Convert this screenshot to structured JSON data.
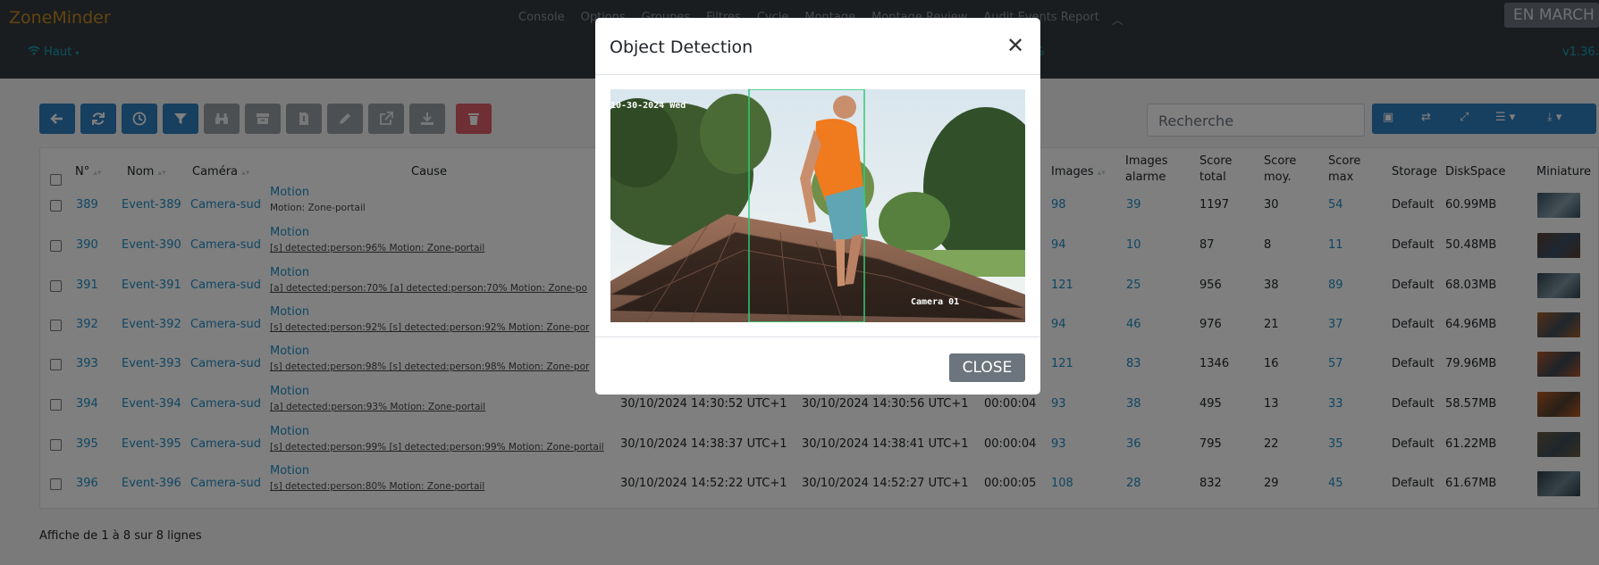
{
  "app": {
    "brand": "ZoneMinder",
    "status_button": "EN MARCH",
    "version": "v1.36."
  },
  "nav": [
    "Console",
    "Options",
    "Groupes",
    "Filtres",
    "Cycle",
    "Montage",
    "Montage Review",
    "Audit Events Report"
  ],
  "nav_collapse_icon": "chevron-up-icon",
  "sub_nav": {
    "bandwidth": "Haut",
    "load_pct": "%"
  },
  "toolbar": {
    "buttons": [
      {
        "name": "back",
        "icon": "arrow-left-icon",
        "state": "enabled"
      },
      {
        "name": "refresh",
        "icon": "refresh-icon",
        "state": "enabled"
      },
      {
        "name": "reset",
        "icon": "history-icon",
        "state": "enabled"
      },
      {
        "name": "filter",
        "icon": "filter-icon",
        "state": "enabled"
      },
      {
        "name": "view",
        "icon": "binoculars-icon",
        "state": "disabled"
      },
      {
        "name": "archive",
        "icon": "archive-icon",
        "state": "disabled"
      },
      {
        "name": "unarchive",
        "icon": "unarchive-icon",
        "state": "disabled"
      },
      {
        "name": "edit",
        "icon": "pencil-icon",
        "state": "disabled"
      },
      {
        "name": "export",
        "icon": "external-link-icon",
        "state": "disabled"
      },
      {
        "name": "download",
        "icon": "download-icon",
        "state": "disabled"
      },
      {
        "name": "delete",
        "icon": "trash-icon",
        "state": "danger"
      }
    ],
    "search_placeholder": "Recherche"
  },
  "table": {
    "headers": {
      "id": "N°",
      "name": "Nom",
      "camera": "Caméra",
      "cause": "Cause",
      "frames": "Images",
      "alarm_frames_1": "Images",
      "alarm_frames_2": "alarme",
      "total_score_1": "Score",
      "total_score_2": "total",
      "avg_score_1": "Score",
      "avg_score_2": "moy.",
      "max_score_1": "Score",
      "max_score_2": "max",
      "storage": "Storage",
      "disk": "DiskSpace",
      "thumb": "Miniature"
    },
    "rows": [
      {
        "id": "389",
        "name": "Event-389",
        "camera": "Camera-sud",
        "cause": "Motion",
        "notes": "Motion: Zone-portail",
        "start": "",
        "end": "",
        "duration": "",
        "frames": "98",
        "alarm": "39",
        "total": "1197",
        "avg": "30",
        "max": "54",
        "storage": "Default",
        "disk": "60.99MB"
      },
      {
        "id": "390",
        "name": "Event-390",
        "camera": "Camera-sud",
        "cause": "Motion",
        "notes": "[s] detected:person:96% Motion: Zone-portail",
        "start": "",
        "end": "",
        "duration": "",
        "frames": "94",
        "alarm": "10",
        "total": "87",
        "avg": "8",
        "max": "11",
        "storage": "Default",
        "disk": "50.48MB"
      },
      {
        "id": "391",
        "name": "Event-391",
        "camera": "Camera-sud",
        "cause": "Motion",
        "notes": "[a] detected:person:70% [a] detected:person:70% Motion: Zone-po",
        "start": "",
        "end": "",
        "duration": "",
        "frames": "121",
        "alarm": "25",
        "total": "956",
        "avg": "38",
        "max": "89",
        "storage": "Default",
        "disk": "68.03MB"
      },
      {
        "id": "392",
        "name": "Event-392",
        "camera": "Camera-sud",
        "cause": "Motion",
        "notes": "[s] detected:person:92% [s] detected:person:92% Motion: Zone-por",
        "start": "",
        "end": "",
        "duration": "",
        "frames": "94",
        "alarm": "46",
        "total": "976",
        "avg": "21",
        "max": "37",
        "storage": "Default",
        "disk": "64.96MB"
      },
      {
        "id": "393",
        "name": "Event-393",
        "camera": "Camera-sud",
        "cause": "Motion",
        "notes": "[s] detected:person:98% [s] detected:person:98% Motion: Zone-por",
        "start": "",
        "end": "",
        "duration": "",
        "frames": "121",
        "alarm": "83",
        "total": "1346",
        "avg": "16",
        "max": "57",
        "storage": "Default",
        "disk": "79.96MB"
      },
      {
        "id": "394",
        "name": "Event-394",
        "camera": "Camera-sud",
        "cause": "Motion",
        "notes": "[a] detected:person:93% Motion: Zone-portail",
        "start": "30/10/2024 14:30:52 UTC+1",
        "end": "30/10/2024 14:30:56 UTC+1",
        "duration": "00:00:04",
        "frames": "93",
        "alarm": "38",
        "total": "495",
        "avg": "13",
        "max": "33",
        "storage": "Default",
        "disk": "58.57MB"
      },
      {
        "id": "395",
        "name": "Event-395",
        "camera": "Camera-sud",
        "cause": "Motion",
        "notes": "[s] detected:person:99% [s] detected:person:99% Motion: Zone-portail",
        "start": "30/10/2024 14:38:37 UTC+1",
        "end": "30/10/2024 14:38:41 UTC+1",
        "duration": "00:00:04",
        "frames": "93",
        "alarm": "36",
        "total": "795",
        "avg": "22",
        "max": "35",
        "storage": "Default",
        "disk": "61.22MB"
      },
      {
        "id": "396",
        "name": "Event-396",
        "camera": "Camera-sud",
        "cause": "Motion",
        "notes": "[s] detected:person:80% Motion: Zone-portail",
        "start": "30/10/2024 14:52:22 UTC+1",
        "end": "30/10/2024 14:52:27 UTC+1",
        "duration": "00:00:05",
        "frames": "108",
        "alarm": "28",
        "total": "832",
        "avg": "29",
        "max": "45",
        "storage": "Default",
        "disk": "61.67MB"
      }
    ]
  },
  "footer": "Affiche de 1 à 8 sur 8 lignes",
  "modal": {
    "title": "Object Detection",
    "close_label": "CLOSE",
    "osd_date": "10-30-2024 Wed",
    "osd_camera": "Camera 01"
  },
  "colors": {
    "navbar": "#343a40",
    "brand": "#c58b1d",
    "primary": "#2e7fbf",
    "link": "#1f8dc6",
    "danger": "#dc5f6a"
  }
}
